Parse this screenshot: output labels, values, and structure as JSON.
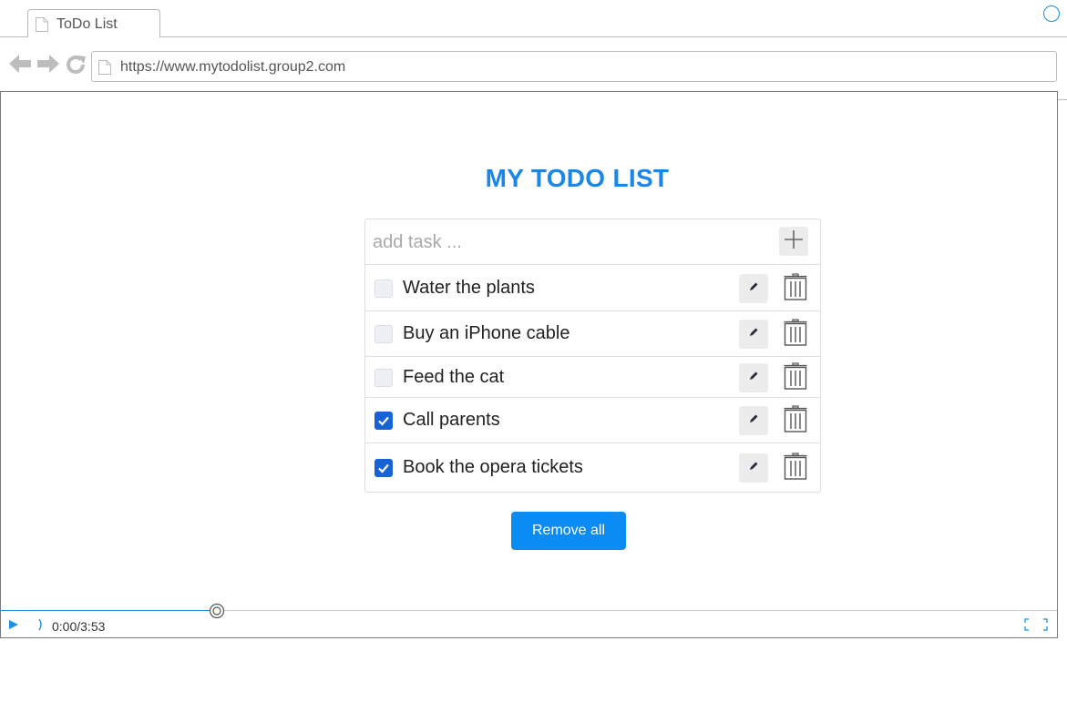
{
  "browser": {
    "tab_title": "ToDo List",
    "url": "https://www.mytodolist.group2.com",
    "accent_color": "#1a8fe3"
  },
  "app": {
    "title": "MY TODO LIST",
    "add_placeholder": "add task ...",
    "tasks": [
      {
        "label": "Water the plants",
        "done": false
      },
      {
        "label": "Buy an iPhone cable",
        "done": false
      },
      {
        "label": "Feed the cat",
        "done": false
      },
      {
        "label": "Call parents",
        "done": true
      },
      {
        "label": "Book the opera tickets",
        "done": true
      }
    ],
    "remove_all_label": "Remove all",
    "title_color": "#1a86e8",
    "button_color": "#0b8cf5",
    "checked_color": "#1763d6"
  },
  "player": {
    "time": "0:00/3:53"
  },
  "icons": [
    "page-icon",
    "back-arrow-icon",
    "forward-arrow-icon",
    "reload-icon",
    "plus-icon",
    "pencil-icon",
    "trash-icon",
    "checkmark-icon",
    "play-icon",
    "volume-icon",
    "fullscreen-icon"
  ]
}
